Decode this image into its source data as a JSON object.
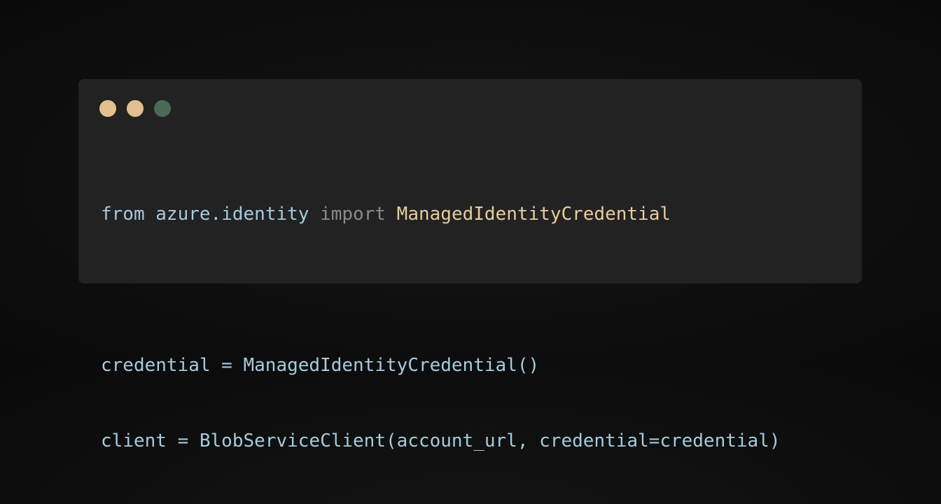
{
  "window": {
    "controls": [
      {
        "name": "close",
        "color": "#e2c08f"
      },
      {
        "name": "minimize",
        "color": "#e2c08f"
      },
      {
        "name": "maximize",
        "color": "#4a6a57"
      }
    ]
  },
  "colors": {
    "background": "#0e0e0e",
    "panel": "#222222",
    "default_text": "#a5cbdc",
    "keyword_muted": "#8a8a8a",
    "class_name": "#e8cc9a"
  },
  "code": {
    "line1": {
      "kw_from": "from",
      "module": "azure.identity",
      "kw_import": "import",
      "imported": "ManagedIdentityCredential"
    },
    "line3": {
      "text": "credential = ManagedIdentityCredential()"
    },
    "line4": {
      "text": "client = BlobServiceClient(account_url, credential=credential)"
    }
  }
}
